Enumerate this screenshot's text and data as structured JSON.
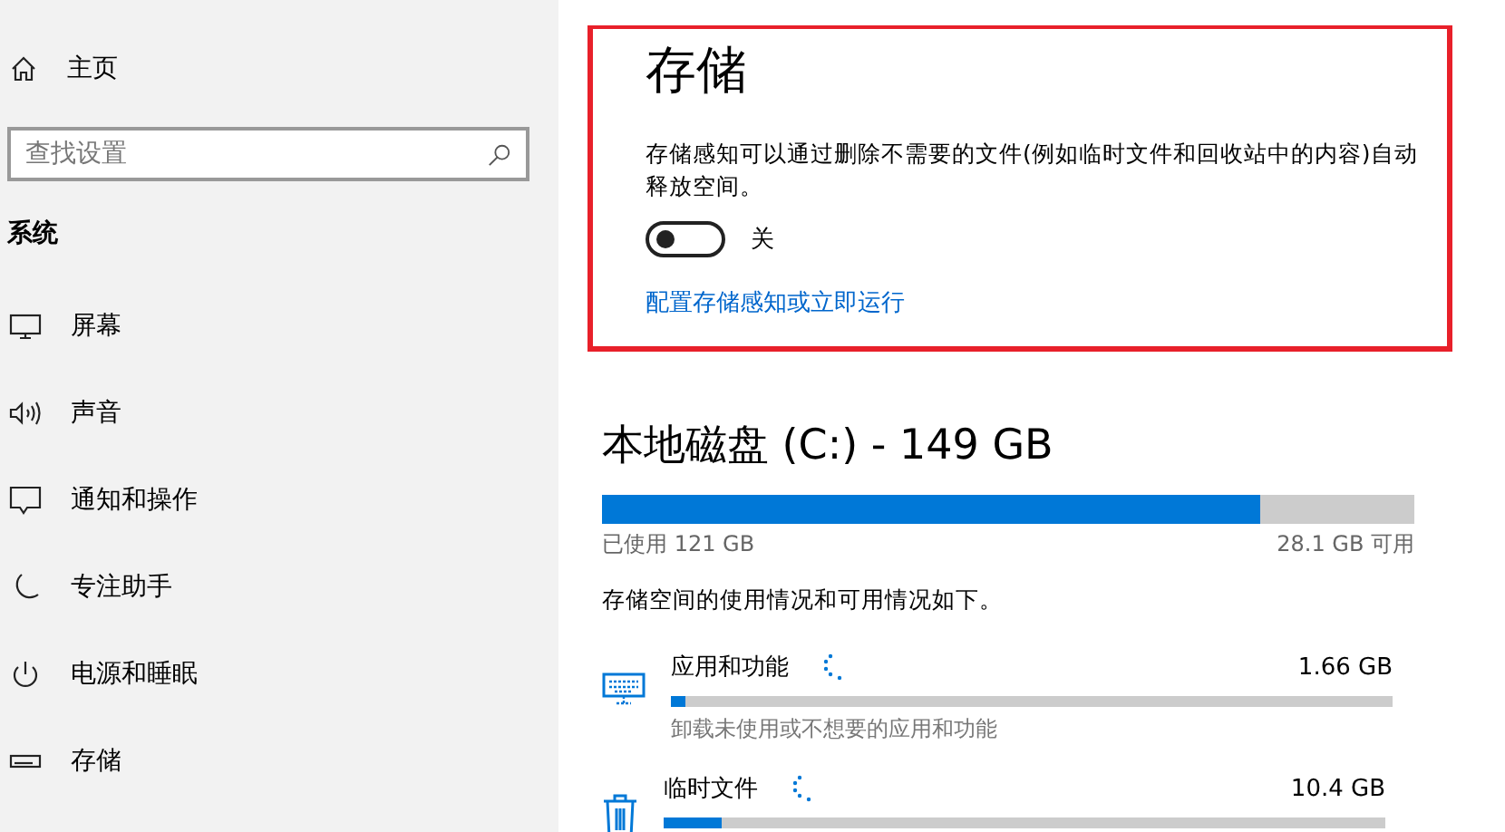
{
  "sidebar": {
    "home": {
      "label": "主页"
    },
    "search": {
      "placeholder": "查找设置"
    },
    "section": "系统",
    "items": [
      {
        "label": "屏幕",
        "kind": "display"
      },
      {
        "label": "声音",
        "kind": "sound"
      },
      {
        "label": "通知和操作",
        "kind": "notification"
      },
      {
        "label": "专注助手",
        "kind": "moon"
      },
      {
        "label": "电源和睡眠",
        "kind": "power"
      },
      {
        "label": "存储",
        "kind": "storage"
      }
    ]
  },
  "storage_sense": {
    "title": "存储",
    "description": "存储感知可以通过删除不需要的文件(例如临时文件和回收站中的内容)自动释放空间。",
    "toggle": {
      "on": false,
      "label": "关"
    },
    "link": "配置存储感知或立即运行"
  },
  "disk": {
    "title": "本地磁盘 (C:) - 149 GB",
    "level": 0.81,
    "used": "已使用 121 GB",
    "free": "28.1 GB 可用",
    "summary": "存储空间的使用情况和可用情况如下。",
    "categories": [
      {
        "kind": "apps",
        "name": "应用和功能",
        "size": "1.66 GB",
        "level": 0.02,
        "subtitle": "卸载未使用或不想要的应用和功能"
      },
      {
        "kind": "temp",
        "name": "临时文件",
        "size": "10.4 GB",
        "level": 0.08
      }
    ]
  }
}
